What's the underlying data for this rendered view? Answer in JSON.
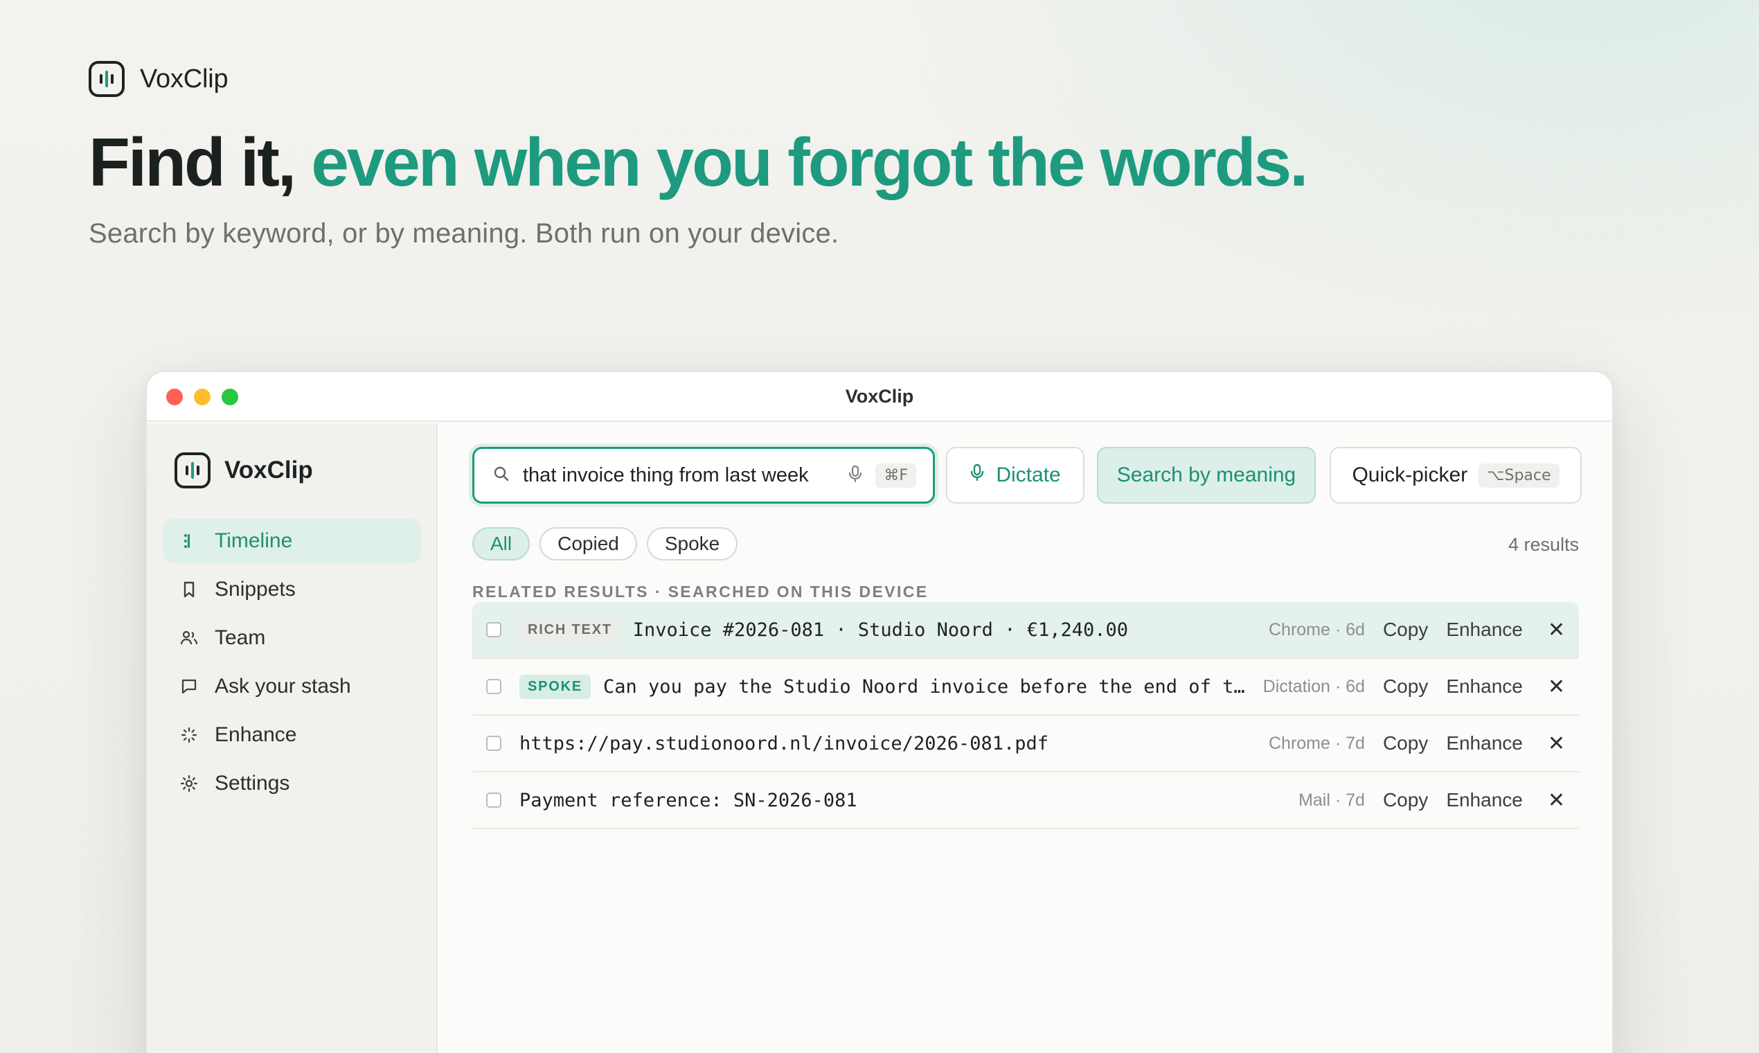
{
  "hero": {
    "brand_name": "VoxClip",
    "headline_dark": "Find it,",
    "headline_accent": "even when you forgot the words.",
    "subtitle": "Search by keyword, or by meaning. Both run on your device.",
    "accent_color": "#1e9a7f"
  },
  "window": {
    "title": "VoxClip"
  },
  "sidebar": {
    "brand_name": "VoxClip",
    "items": [
      {
        "label": "Timeline",
        "icon": "timeline-icon",
        "active": true
      },
      {
        "label": "Snippets",
        "icon": "bookmark-icon",
        "active": false
      },
      {
        "label": "Team",
        "icon": "team-icon",
        "active": false
      },
      {
        "label": "Ask your stash",
        "icon": "chat-icon",
        "active": false
      },
      {
        "label": "Enhance",
        "icon": "sparkle-icon",
        "active": false
      },
      {
        "label": "Settings",
        "icon": "gear-icon",
        "active": false
      }
    ]
  },
  "search": {
    "value": "that invoice thing from last week",
    "shortcut": "⌘F",
    "dictate_label": "Dictate",
    "meaning_label": "Search by meaning",
    "quick_label": "Quick-picker",
    "quick_shortcut": "⌥Space"
  },
  "filters": {
    "chips": [
      "All",
      "Copied",
      "Spoke"
    ],
    "active": "All",
    "count": "4 results"
  },
  "results": {
    "section_label": "RELATED RESULTS · SEARCHED ON THIS DEVICE",
    "copy_label": "Copy",
    "enhance_label": "Enhance",
    "close_glyph": "✕",
    "rows": [
      {
        "tag": "RICH TEXT",
        "content": "Invoice #2026-081 · Studio Noord · €1,240.00",
        "meta": "Chrome · 6d"
      },
      {
        "tag": "SPOKE",
        "content": "Can you pay the Studio Noord invoice before the end of th…",
        "meta": "Dictation · 6d"
      },
      {
        "tag": "",
        "content": "https://pay.studionoord.nl/invoice/2026-081.pdf",
        "meta": "Chrome · 7d"
      },
      {
        "tag": "",
        "content": "Payment reference: SN-2026-081",
        "meta": "Mail · 7d"
      }
    ]
  }
}
